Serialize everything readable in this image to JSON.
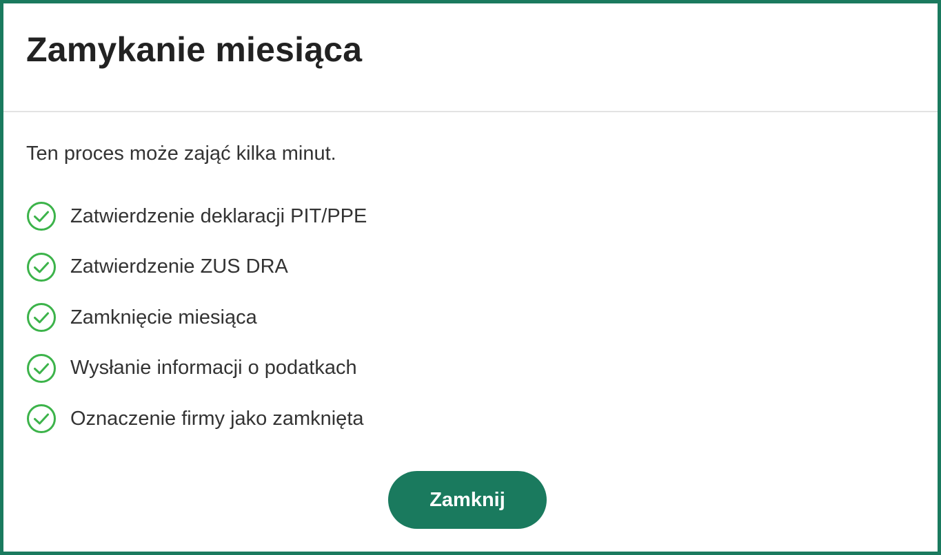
{
  "dialog": {
    "title": "Zamykanie miesiąca",
    "intro": "Ten proces może zająć kilka minut.",
    "steps": [
      {
        "label": "Zatwierdzenie deklaracji PIT/PPE",
        "icon": "check-circle-icon",
        "status": "done"
      },
      {
        "label": "Zatwierdzenie ZUS DRA",
        "icon": "check-circle-icon",
        "status": "done"
      },
      {
        "label": "Zamknięcie miesiąca",
        "icon": "check-circle-icon",
        "status": "done"
      },
      {
        "label": "Wysłanie informacji o podatkach",
        "icon": "check-circle-icon",
        "status": "done"
      },
      {
        "label": "Oznaczenie firmy jako zamknięta",
        "icon": "check-circle-icon",
        "status": "done"
      }
    ],
    "close_label": "Zamknij"
  },
  "colors": {
    "accent": "#1a7a5e",
    "check": "#3cb34a",
    "text": "#333333",
    "title": "#222222"
  }
}
